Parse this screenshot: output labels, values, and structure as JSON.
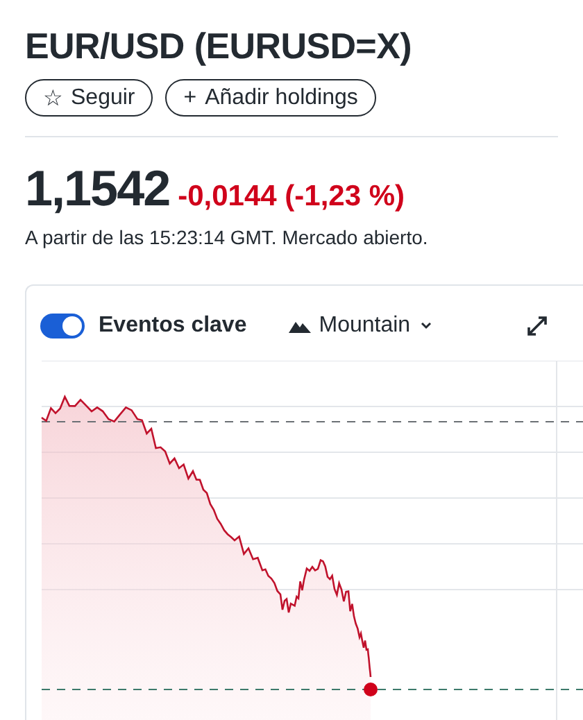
{
  "title": "EUR/USD (EURUSD=X)",
  "buttons": [
    {
      "icon": "☆",
      "label": "Seguir"
    },
    {
      "icon": "+",
      "label": "Añadir holdings"
    }
  ],
  "quote": {
    "price": "1,1542",
    "change": "-0,0144 (-1,23 %)",
    "note": "A partir de las 15:23:14 GMT. Mercado abierto."
  },
  "chart": {
    "key_events": {
      "label": "Eventos clave",
      "on": true
    },
    "type_menu": {
      "label": "Mountain"
    }
  }
}
